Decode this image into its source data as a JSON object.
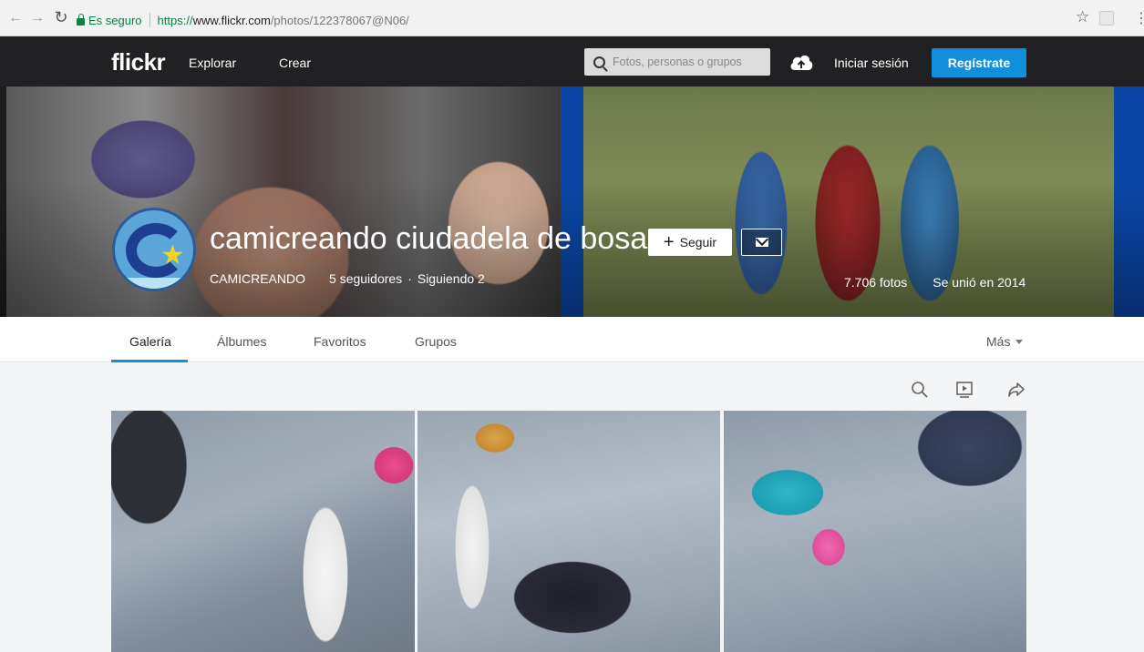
{
  "browser": {
    "secure_label": "Es seguro",
    "url_scheme": "https://",
    "url_host": "www.flickr.com",
    "url_path": "/photos/122378067@N06/"
  },
  "header": {
    "logo": "flickr",
    "nav": [
      "Explorar",
      "Crear"
    ],
    "search_placeholder": "Fotos, personas o grupos",
    "signin_label": "Iniciar sesión",
    "register_label": "Regístrate"
  },
  "profile": {
    "name": "camicreando ciudadela de bosa",
    "follow_label": "Seguir",
    "username": "CAMICREANDO",
    "followers": "5 seguidores",
    "following": "Siguiendo 2",
    "photos": "7.706 fotos",
    "joined": "Se unió en 2014"
  },
  "tabs": {
    "items": [
      "Galería",
      "Álbumes",
      "Favoritos",
      "Grupos"
    ],
    "more_label": "Más",
    "active": "Galería"
  },
  "colors": {
    "header_bg": "#212124",
    "accent": "#128fdc",
    "secure_green": "#0b8043",
    "content_bg": "#f3f5f6"
  }
}
